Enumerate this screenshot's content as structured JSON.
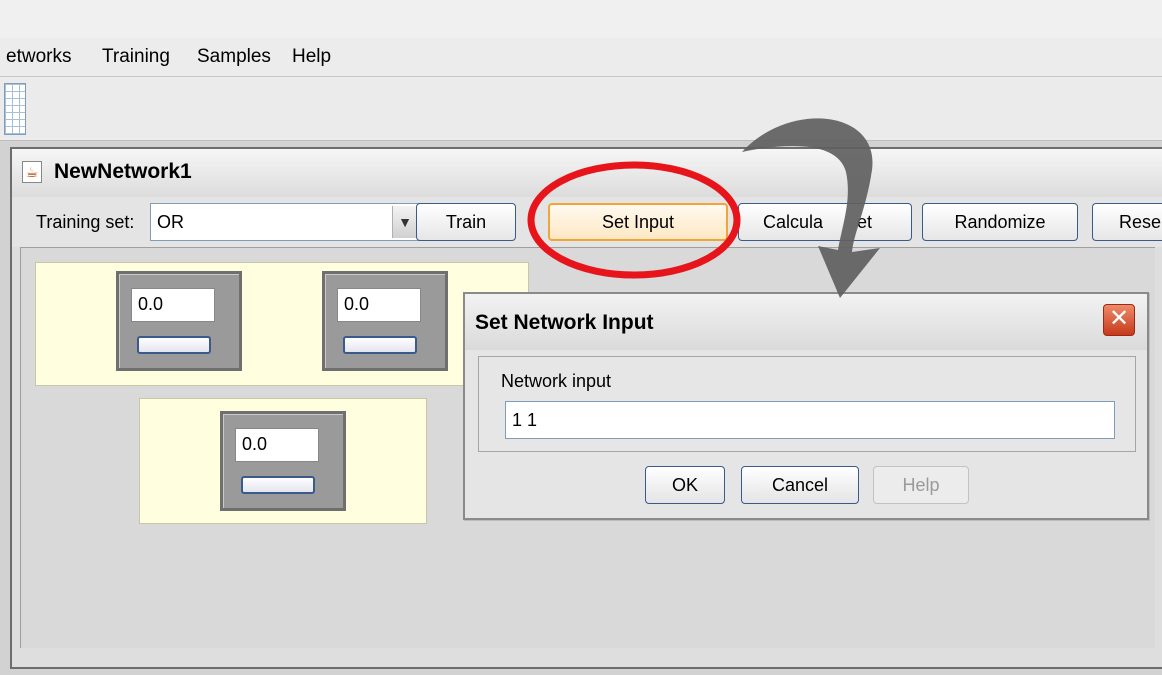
{
  "menubar": {
    "items": [
      "etworks",
      "Training",
      "Samples",
      "Help"
    ]
  },
  "toolbar": {
    "icon": "grid-icon"
  },
  "frame": {
    "title": "NewNetwork1",
    "icon": "java-cup-icon"
  },
  "controls": {
    "training_set_label": "Training set:",
    "training_set_value": "OR",
    "buttons": [
      "Train",
      "Set Input",
      "Calcula",
      "et",
      "Randomize",
      "Rese"
    ]
  },
  "network": {
    "input_layer": [
      "0.0",
      "0.0"
    ],
    "output_layer": [
      "0.0"
    ]
  },
  "dialog": {
    "title": "Set Network Input",
    "field_label": "Network input",
    "field_value": "1 1",
    "buttons": {
      "ok": "OK",
      "cancel": "Cancel",
      "help": "Help"
    }
  },
  "annotation": {
    "circle_color": "#e8141b",
    "arrow_color": "#606060"
  }
}
